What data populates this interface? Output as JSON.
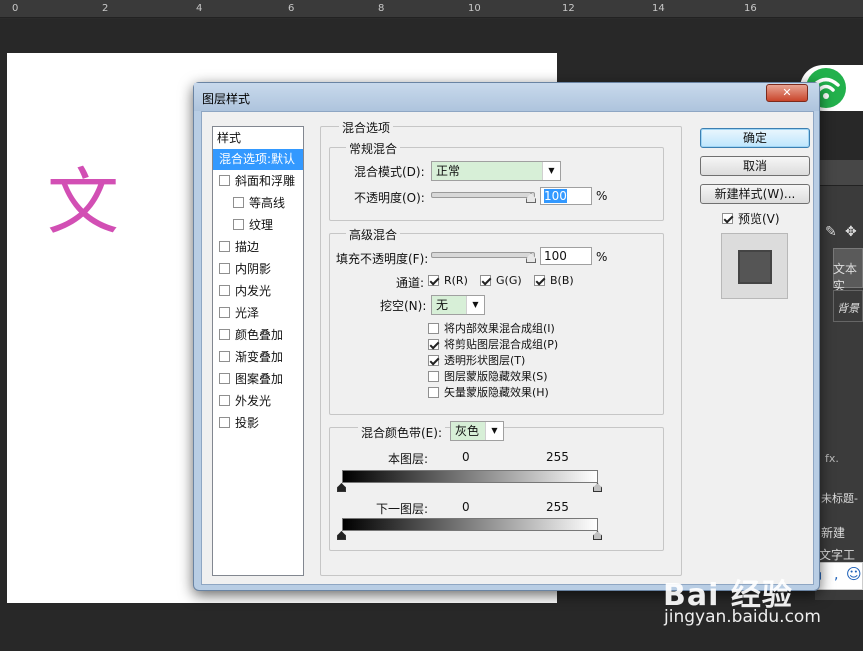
{
  "ruler": {
    "numbers": [
      "0",
      "2",
      "4",
      "6",
      "8",
      "10",
      "12",
      "14",
      "16"
    ]
  },
  "canvas": {
    "text": "文 ル"
  },
  "right_panel": {
    "layer_name": "文本实",
    "bg_layer": "背景",
    "untitled": "未标题-",
    "new": "新建",
    "text_tool": "文字工具",
    "fx": "fx."
  },
  "sogou": {
    "label": "中",
    "icon": "S"
  },
  "watermark": {
    "brand": "Bai  经验",
    "url": "jingyan.baidu.com"
  },
  "dialog": {
    "title": "图层样式",
    "close": "✕",
    "styles_header": "样式",
    "styles": [
      {
        "label": "混合选项:默认",
        "checkbox": false,
        "selected": true,
        "indent": false
      },
      {
        "label": "斜面和浮雕",
        "checkbox": true,
        "checked": false,
        "indent": false
      },
      {
        "label": "等高线",
        "checkbox": true,
        "checked": false,
        "indent": true
      },
      {
        "label": "纹理",
        "checkbox": true,
        "checked": false,
        "indent": true
      },
      {
        "label": "描边",
        "checkbox": true,
        "checked": false,
        "indent": false
      },
      {
        "label": "内阴影",
        "checkbox": true,
        "checked": false,
        "indent": false
      },
      {
        "label": "内发光",
        "checkbox": true,
        "checked": false,
        "indent": false
      },
      {
        "label": "光泽",
        "checkbox": true,
        "checked": false,
        "indent": false
      },
      {
        "label": "颜色叠加",
        "checkbox": true,
        "checked": false,
        "indent": false
      },
      {
        "label": "渐变叠加",
        "checkbox": true,
        "checked": false,
        "indent": false
      },
      {
        "label": "图案叠加",
        "checkbox": true,
        "checked": false,
        "indent": false
      },
      {
        "label": "外发光",
        "checkbox": true,
        "checked": false,
        "indent": false
      },
      {
        "label": "投影",
        "checkbox": true,
        "checked": false,
        "indent": false
      }
    ],
    "blend_options_title": "混合选项",
    "general_title": "常规混合",
    "blend_mode_label": "混合模式(D):",
    "blend_mode_value": "正常",
    "opacity_label": "不透明度(O):",
    "opacity_value": "100",
    "percent": "%",
    "advanced_title": "高级混合",
    "fill_opacity_label": "填充不透明度(F):",
    "fill_opacity_value": "100",
    "channels_label": "通道:",
    "channel_r": "R(R)",
    "channel_g": "G(G)",
    "channel_b": "B(B)",
    "knockout_label": "挖空(N):",
    "knockout_value": "无",
    "options": [
      {
        "label": "将内部效果混合成组(I)",
        "checked": false
      },
      {
        "label": "将剪贴图层混合成组(P)",
        "checked": true
      },
      {
        "label": "透明形状图层(T)",
        "checked": true
      },
      {
        "label": "图层蒙版隐藏效果(S)",
        "checked": false
      },
      {
        "label": "矢量蒙版隐藏效果(H)",
        "checked": false
      }
    ],
    "blend_if_label": "混合颜色带(E):",
    "blend_if_value": "灰色",
    "this_layer_label": "本图层:",
    "this_layer_min": "0",
    "this_layer_max": "255",
    "underlying_label": "下一图层:",
    "underlying_min": "0",
    "underlying_max": "255",
    "ok": "确定",
    "cancel": "取消",
    "new_style": "新建样式(W)...",
    "preview_label": "预览(V)",
    "preview_checked": true
  },
  "colors": {
    "accent_blue": "#3399ff",
    "combo_green": "#d7efd7",
    "canvas_text": "#d24fb4",
    "wifi_green": "#22b14c"
  }
}
